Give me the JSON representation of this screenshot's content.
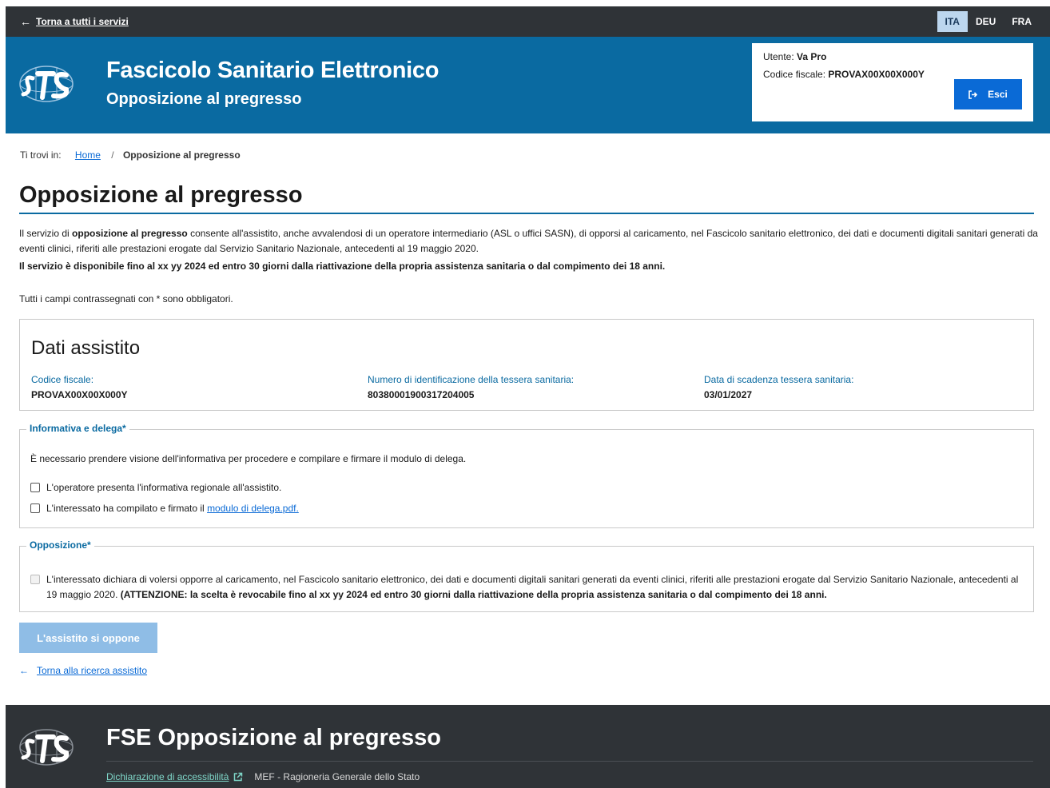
{
  "topbar": {
    "back_label": "Torna a tutti i servizi",
    "languages": [
      "ITA",
      "DEU",
      "FRA"
    ],
    "active_language": "ITA"
  },
  "header": {
    "title": "Fascicolo Sanitario Elettronico",
    "subtitle": "Opposizione al pregresso",
    "user_label": "Utente:",
    "user_name": "Va Pro",
    "cf_label": "Codice fiscale:",
    "cf_value": "PROVAX00X00X000Y",
    "logout_label": "Esci"
  },
  "breadcrumb": {
    "prefix": "Ti trovi in:",
    "home": "Home",
    "separator": "/",
    "current": "Opposizione al pregresso"
  },
  "main": {
    "title": "Opposizione al pregresso",
    "intro_pre": "Il servizio di ",
    "intro_bold": "opposizione al pregresso",
    "intro_post": " consente all'assistito, anche avvalendosi di un operatore intermediario (ASL o uffici SASN), di opporsi al caricamento, nel Fascicolo sanitario elettronico, dei dati e documenti digitali sanitari generati da eventi clinici, riferiti alle prestazioni erogate dal Servizio Sanitario Nazionale, antecedenti al 19 maggio 2020.",
    "availability": "Il servizio è disponibile fino al xx yy 2024 ed entro 30 giorni dalla riattivazione della propria assistenza sanitaria o dal compimento dei 18 anni.",
    "required_note": "Tutti i campi contrassegnati con * sono obbligatori."
  },
  "dati": {
    "title": "Dati assistito",
    "fields": [
      {
        "label": "Codice fiscale:",
        "value": "PROVAX00X00X000Y"
      },
      {
        "label": "Numero di identificazione della tessera sanitaria:",
        "value": "80380001900317204005"
      },
      {
        "label": "Data di scadenza tessera sanitaria:",
        "value": "03/01/2027"
      }
    ]
  },
  "informativa": {
    "legend": "Informativa e delega*",
    "text": "È necessario prendere visione dell'informativa per procedere e compilare e firmare il modulo di delega.",
    "check1": "L'operatore presenta l'informativa regionale all'assistito.",
    "check2_pre": "L'interessato ha compilato e firmato il ",
    "check2_link": "modulo di delega.pdf."
  },
  "opposizione": {
    "legend": "Opposizione*",
    "text": "L'interessato dichiara di volersi opporre al caricamento, nel Fascicolo sanitario elettronico, dei dati e documenti digitali sanitari generati da eventi clinici, riferiti alle prestazioni erogate dal Servizio Sanitario Nazionale, antecedenti al 19 maggio 2020. ",
    "warning": "(ATTENZIONE: la scelta è revocabile fino al xx yy 2024 ed entro 30 giorni dalla riattivazione della propria assistenza sanitaria o dal compimento dei 18 anni."
  },
  "actions": {
    "submit_label": "L'assistito si oppone",
    "back_label": "Torna alla ricerca assistito"
  },
  "footer": {
    "title": "FSE Opposizione al pregresso",
    "accessibility_link": "Dichiarazione di accessibilità",
    "org": "MEF - Ragioneria Generale dello Stato"
  },
  "colors": {
    "header_blue": "#0a6aa1",
    "dark_bar": "#2f3337",
    "button_blue": "#0a6ad6",
    "disabled_button": "#8fbde6"
  }
}
